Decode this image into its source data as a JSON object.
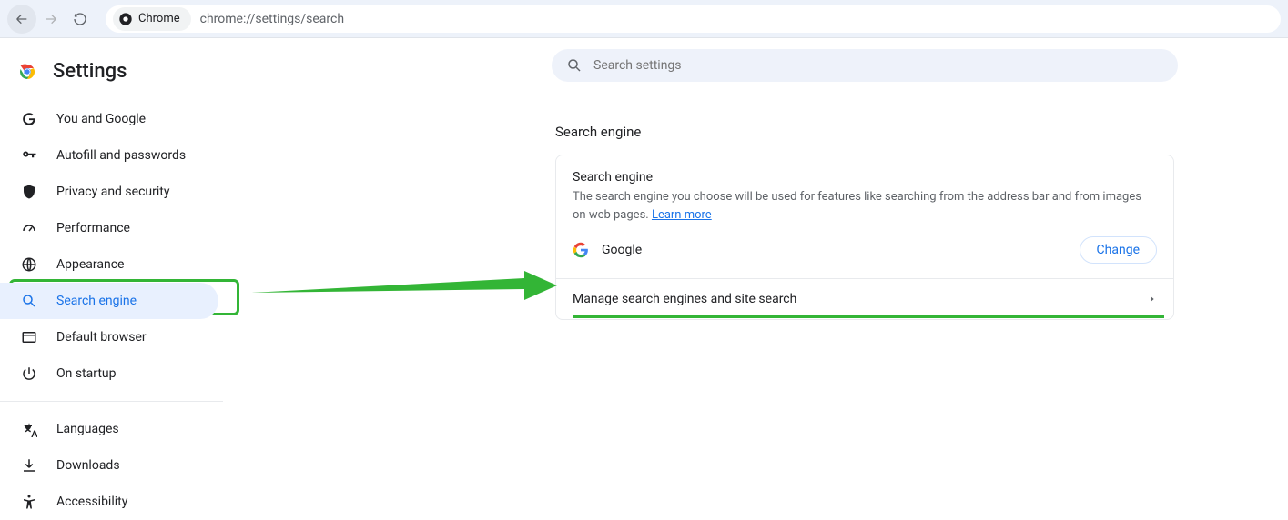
{
  "toolbar": {
    "chip_label": "Chrome",
    "url": "chrome://settings/search"
  },
  "sidebar": {
    "title": "Settings",
    "items": [
      {
        "label": "You and Google"
      },
      {
        "label": "Autofill and passwords"
      },
      {
        "label": "Privacy and security"
      },
      {
        "label": "Performance"
      },
      {
        "label": "Appearance"
      },
      {
        "label": "Search engine"
      },
      {
        "label": "Default browser"
      },
      {
        "label": "On startup"
      },
      {
        "label": "Languages"
      },
      {
        "label": "Downloads"
      },
      {
        "label": "Accessibility"
      }
    ]
  },
  "search": {
    "placeholder": "Search settings"
  },
  "section": {
    "title": "Search engine"
  },
  "card": {
    "row_title": "Search engine",
    "desc_prefix": "The search engine you choose will be used for features like searching from the address bar and from images on web pages. ",
    "learn_more": "Learn more",
    "current_engine": "Google",
    "change_label": "Change",
    "manage_label": "Manage search engines and site search"
  }
}
